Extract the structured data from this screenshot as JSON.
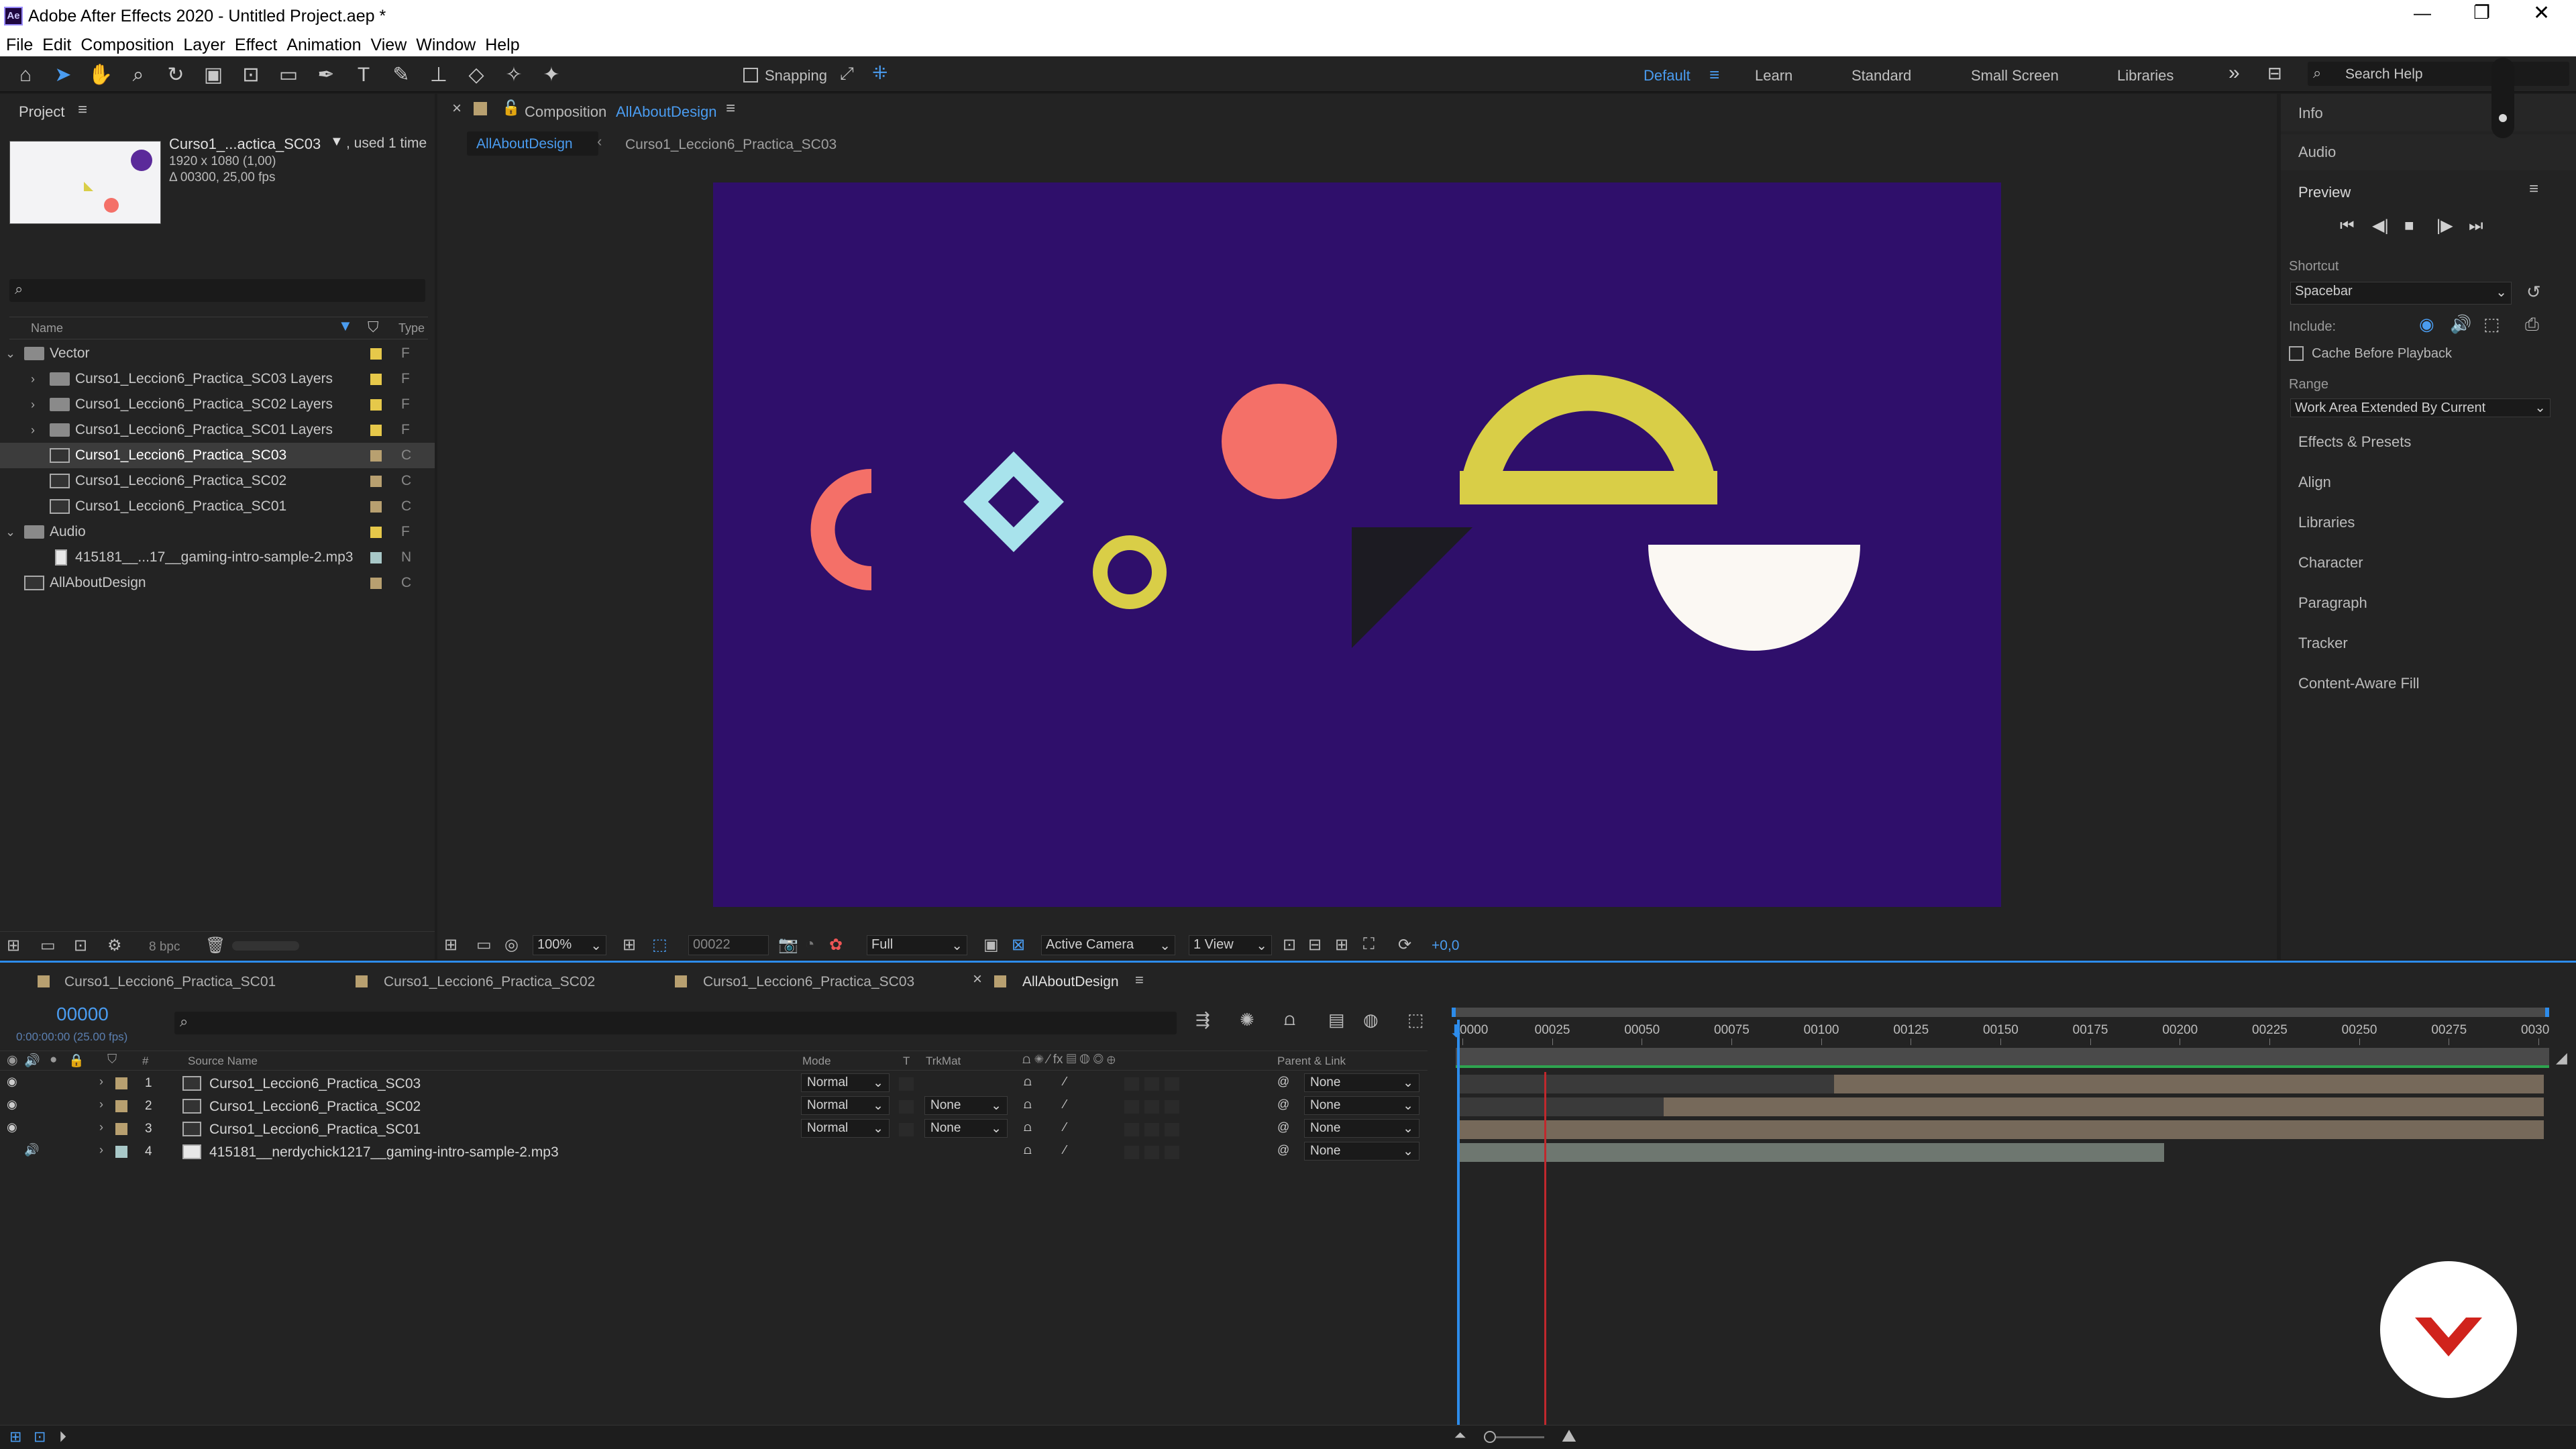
{
  "app": {
    "title": "Adobe After Effects 2020 - Untitled Project.aep *",
    "logo_text": "Ae"
  },
  "menu": [
    "File",
    "Edit",
    "Composition",
    "Layer",
    "Effect",
    "Animation",
    "View",
    "Window",
    "Help"
  ],
  "toolbar": {
    "snapping_label": "Snapping"
  },
  "workspaces": {
    "items": [
      "Default",
      "Learn",
      "Standard",
      "Small Screen",
      "Libraries"
    ],
    "active": "Default",
    "search_placeholder": "Search Help"
  },
  "project": {
    "title": "Project",
    "selected_name": "Curso1_...actica_SC03",
    "used": ", used 1 time",
    "dims": "1920 x 1080 (1,00)",
    "duration": "Δ 00300, 25,00 fps",
    "col_name": "Name",
    "col_type": "Type",
    "items": [
      {
        "name": "Vector",
        "type": "F",
        "level": 0,
        "kind": "folder",
        "open": true
      },
      {
        "name": "Curso1_Leccion6_Practica_SC03 Layers",
        "type": "F",
        "level": 1,
        "kind": "folder"
      },
      {
        "name": "Curso1_Leccion6_Practica_SC02 Layers",
        "type": "F",
        "level": 1,
        "kind": "folder"
      },
      {
        "name": "Curso1_Leccion6_Practica_SC01 Layers",
        "type": "F",
        "level": 1,
        "kind": "folder"
      },
      {
        "name": "Curso1_Leccion6_Practica_SC03",
        "type": "C",
        "level": 1,
        "kind": "comp",
        "selected": true
      },
      {
        "name": "Curso1_Leccion6_Practica_SC02",
        "type": "C",
        "level": 1,
        "kind": "comp"
      },
      {
        "name": "Curso1_Leccion6_Practica_SC01",
        "type": "C",
        "level": 1,
        "kind": "comp"
      },
      {
        "name": "Audio",
        "type": "F",
        "level": 0,
        "kind": "folder",
        "open": true
      },
      {
        "name": "415181__...17__gaming-intro-sample-2.mp3",
        "type": "N",
        "level": 1,
        "kind": "audio"
      },
      {
        "name": "AllAboutDesign",
        "type": "C",
        "level": 0,
        "kind": "comp"
      }
    ],
    "bpc": "8 bpc"
  },
  "composition": {
    "tab_prefix": "Composition",
    "tab_name": "AllAboutDesign",
    "breadcrumb": [
      "AllAboutDesign",
      "Curso1_Leccion6_Practica_SC03"
    ],
    "bg": "#2f0f6b",
    "zoom": "100%",
    "timecode": "00022",
    "resolution": "Full",
    "camera": "Active Camera",
    "view": "1 View",
    "exposure": "+0,0"
  },
  "right_panel": {
    "items_top": [
      "Info",
      "Audio"
    ],
    "preview_title": "Preview",
    "shortcut_label": "Shortcut",
    "shortcut_value": "Spacebar",
    "include_label": "Include:",
    "cache_label": "Cache Before Playback",
    "range_label": "Range",
    "range_value": "Work Area Extended By Current",
    "items_bottom": [
      "Effects & Presets",
      "Align",
      "Libraries",
      "Character",
      "Paragraph",
      "Tracker",
      "Content-Aware Fill"
    ]
  },
  "timeline": {
    "tabs": [
      "Curso1_Leccion6_Practica_SC01",
      "Curso1_Leccion6_Practica_SC02",
      "Curso1_Leccion6_Practica_SC03",
      "AllAboutDesign"
    ],
    "active_tab": "AllAboutDesign",
    "timecode": "00000",
    "timecode_sub": "0:00:00:00 (25.00 fps)",
    "cols": {
      "source": "Source Name",
      "mode": "Mode",
      "t": "T",
      "trkmat": "TrkMat",
      "parent": "Parent & Link"
    },
    "layers": [
      {
        "num": "1",
        "name": "Curso1_Leccion6_Practica_SC03",
        "mode": "Normal",
        "trkmat": "",
        "parent": "None",
        "bar_start": 0.345,
        "bar_end": 1.0
      },
      {
        "num": "2",
        "name": "Curso1_Leccion6_Practica_SC02",
        "mode": "Normal",
        "trkmat": "None",
        "parent": "None",
        "bar_start": 0.188,
        "bar_end": 1.0
      },
      {
        "num": "3",
        "name": "Curso1_Leccion6_Practica_SC01",
        "mode": "Normal",
        "trkmat": "None",
        "parent": "None",
        "bar_start": 0.0,
        "bar_end": 1.0
      },
      {
        "num": "4",
        "name": "415181__nerdychick1217__gaming-intro-sample-2.mp3",
        "mode": "",
        "trkmat": "",
        "parent": "None",
        "bar_start": 0.0,
        "bar_end": 0.65
      }
    ],
    "ruler": [
      "0000",
      "00025",
      "00050",
      "00075",
      "00100",
      "00125",
      "00150",
      "00175",
      "00200",
      "00225",
      "00250",
      "00275",
      "0030"
    ],
    "current_frame": 22,
    "total_frames": 300
  },
  "colors": {
    "accent": "#2d8ceb",
    "label_tan": "#b8a070",
    "label_yellow": "#e6c84a",
    "coral": "#f47068",
    "ice": "#a8e3ec",
    "mustard": "#d9ce47",
    "cream": "#fbf8f3",
    "dark": "#1d1d1d"
  }
}
